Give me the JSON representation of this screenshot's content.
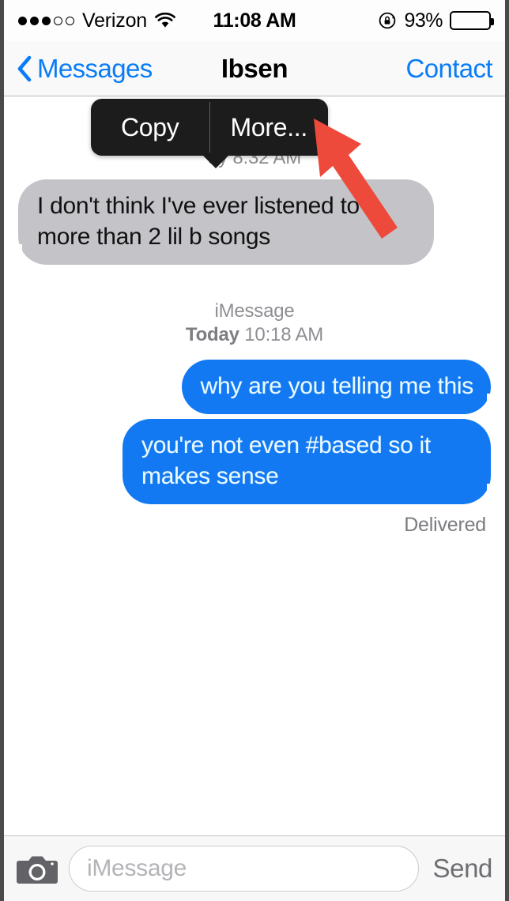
{
  "status_bar": {
    "signal_dots_filled": 3,
    "signal_dots_total": 5,
    "carrier": "Verizon",
    "wifi_icon": "wifi-icon",
    "time": "11:08 AM",
    "rotation_lock_icon": "rotation-lock-icon",
    "battery_percent": "93%",
    "battery_level": 93
  },
  "nav_bar": {
    "back_icon": "chevron-left-icon",
    "back_label": "Messages",
    "title": "Ibsen",
    "right_action": "Contact",
    "accent_color": "#0a7cf7"
  },
  "popup_menu": {
    "items": [
      {
        "label": "Copy"
      },
      {
        "label": "More..."
      }
    ],
    "background_color": "#1c1c1c"
  },
  "annotation": {
    "arrow_icon": "red-arrow-icon",
    "arrow_color": "#ee4a3c",
    "points_to": "More..."
  },
  "conversation": {
    "obscured_timestamp": "ay 8:32 AM",
    "service_label": "iMessage",
    "date_label": "Today",
    "time_label": "10:18 AM",
    "messages": [
      {
        "direction": "incoming",
        "text": "I don't think I've ever listened to more than 2 lil b songs",
        "bubble_color": "#c3c3c8",
        "text_color": "#111111"
      },
      {
        "direction": "outgoing",
        "text": "why are you telling me this",
        "bubble_color": "#1279f2",
        "text_color": "#eafaff"
      },
      {
        "direction": "outgoing",
        "text": "you're not even #based so it makes sense",
        "bubble_color": "#1279f2",
        "text_color": "#eafaff"
      }
    ],
    "delivery_status": "Delivered"
  },
  "input_bar": {
    "camera_icon": "camera-icon",
    "placeholder": "iMessage",
    "value": "",
    "send_label": "Send"
  }
}
